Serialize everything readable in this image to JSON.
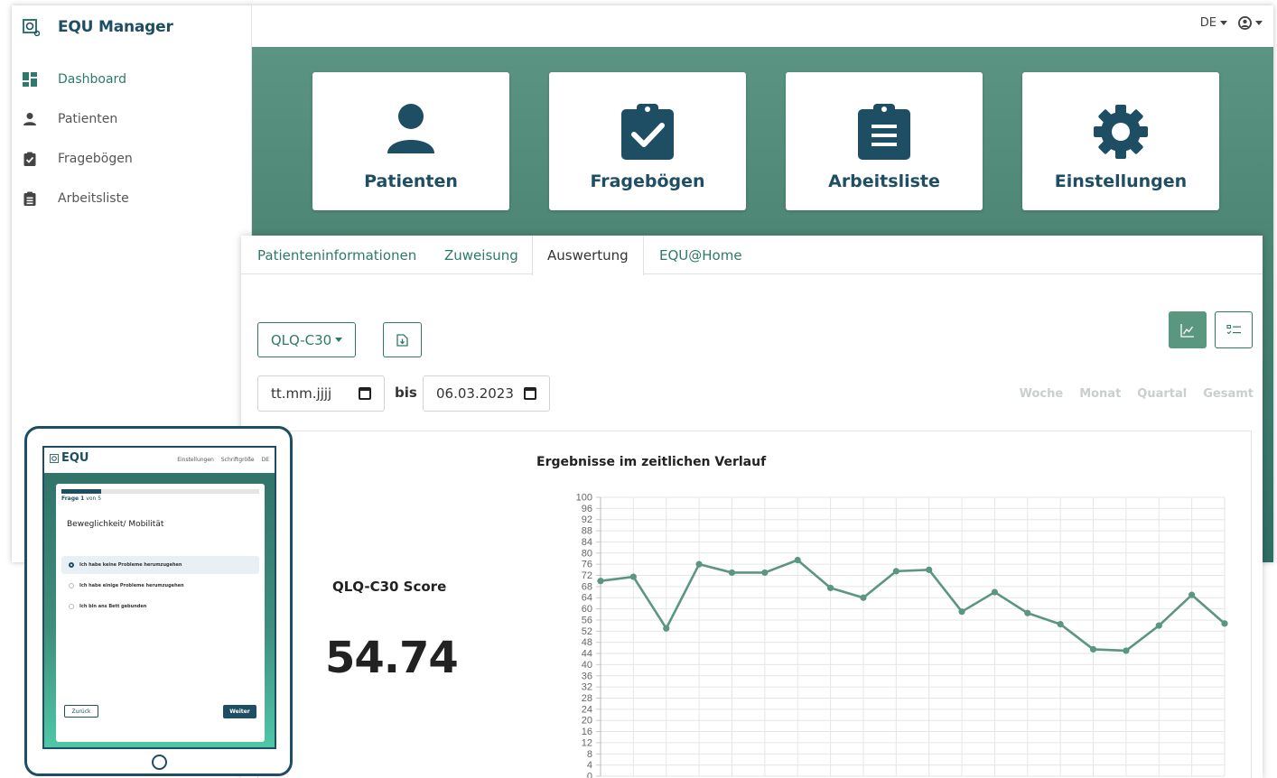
{
  "app": {
    "title": "EQU Manager"
  },
  "sidebar": {
    "items": [
      {
        "label": "Dashboard",
        "icon": "dashboard-icon",
        "active": true
      },
      {
        "label": "Patienten",
        "icon": "user-icon"
      },
      {
        "label": "Fragebögen",
        "icon": "clipboard-check-icon"
      },
      {
        "label": "Arbeitsliste",
        "icon": "clipboard-list-icon"
      }
    ]
  },
  "topbar": {
    "language": "DE",
    "user_icon": "user-circle-icon"
  },
  "tiles": [
    {
      "label": "Patienten",
      "icon": "user-icon"
    },
    {
      "label": "Fragebögen",
      "icon": "clipboard-check-icon"
    },
    {
      "label": "Arbeitsliste",
      "icon": "clipboard-list-icon"
    },
    {
      "label": "Einstellungen",
      "icon": "gear-icon"
    }
  ],
  "panel": {
    "tabs": [
      {
        "label": "Patienteninformationen"
      },
      {
        "label": "Zuweisung"
      },
      {
        "label": "Auswertung",
        "active": true
      },
      {
        "label": "EQU@Home"
      }
    ],
    "questionnaire_select": "QLQ-C30",
    "date_from_placeholder": "tt.mm.jjjj",
    "date_separator": "bis",
    "date_to": "06.03.2023",
    "periods": [
      "Woche",
      "Monat",
      "Quartal",
      "Gesamt"
    ],
    "score_label": "QLQ-C30 Score",
    "score_value": "54.74",
    "chart_title": "Ergebnisse im zeitlichen Verlauf"
  },
  "colors": {
    "primary": "#1d4e63",
    "accent": "#2e7a6a",
    "line": "#5a9680"
  },
  "chart_data": {
    "type": "line",
    "title": "Ergebnisse im zeitlichen Verlauf",
    "ylim": [
      0,
      100
    ],
    "yticks": [
      0,
      4,
      8,
      12,
      16,
      20,
      24,
      28,
      32,
      36,
      40,
      44,
      48,
      52,
      56,
      60,
      64,
      68,
      72,
      76,
      80,
      84,
      88,
      92,
      96,
      100
    ],
    "grid": true,
    "series": [
      {
        "values": [
          70,
          71.5,
          53,
          76,
          73,
          73,
          77.5,
          67.5,
          64,
          73.5,
          74,
          59,
          66,
          58.5,
          54.5,
          45.5,
          45,
          54,
          65,
          54.74
        ]
      }
    ]
  },
  "tablet": {
    "brand": "EQU",
    "menu": [
      "Einstellungen",
      "Schriftgröße",
      "DE"
    ],
    "step_label": "Frage 1",
    "step_of": "von 5",
    "progress": 0.2,
    "question": "Beweglichkeit/ Mobilität",
    "options": [
      {
        "label": "Ich habe keine Probleme herumzugehen",
        "selected": true
      },
      {
        "label": "Ich habe einige Probleme herumzugehen"
      },
      {
        "label": "Ich bin ans Bett gebunden"
      }
    ],
    "back_label": "Zurück",
    "next_label": "Weiter"
  }
}
